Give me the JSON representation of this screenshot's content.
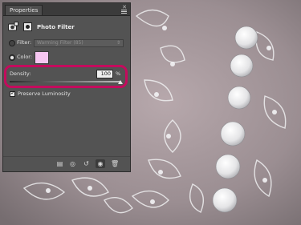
{
  "panel": {
    "tab_label": "Properties",
    "adjustment_title": "Photo Filter",
    "filter_label": "Filter:",
    "filter_value": "Warming Filter (85)",
    "color_label": "Color:",
    "color_value": "#f6c6f1",
    "density_label": "Density:",
    "density_value": "100",
    "density_unit": "%",
    "density_fraction": 1.0,
    "preserve_label": "Preserve Luminosity",
    "preserve_checked": true,
    "filter_selected": false,
    "color_selected": true
  },
  "icons": {
    "close": "close-icon",
    "menu": "panel-menu-icon",
    "adjustment": "photo-filter-icon",
    "mask": "layer-mask-icon",
    "footer": [
      "clip-to-layer-icon",
      "view-previous-state-icon",
      "reset-icon",
      "visibility-icon",
      "delete-icon"
    ]
  },
  "colors": {
    "highlight": "#c40b5d",
    "panel_bg": "#535353"
  }
}
